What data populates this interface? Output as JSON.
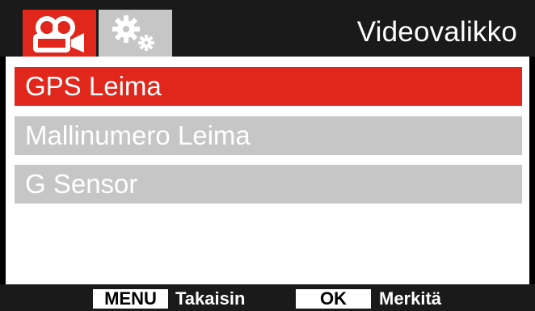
{
  "header": {
    "title": "Videovalikko",
    "tabs": [
      {
        "id": "video",
        "icon": "video-camera-icon",
        "active": true
      },
      {
        "id": "settings",
        "icon": "gears-icon",
        "active": false
      }
    ]
  },
  "menu": {
    "items": [
      {
        "label": "GPS Leima",
        "selected": true
      },
      {
        "label": "Mallinumero Leima",
        "selected": false
      },
      {
        "label": "G Sensor",
        "selected": false
      }
    ]
  },
  "footer": {
    "menu_key": "MENU",
    "menu_action": "Takaisin",
    "ok_key": "OK",
    "ok_action": "Merkitä"
  },
  "colors": {
    "accent": "#e1261c",
    "inactive": "#c6c6c6",
    "bar": "#1a1a1a"
  }
}
